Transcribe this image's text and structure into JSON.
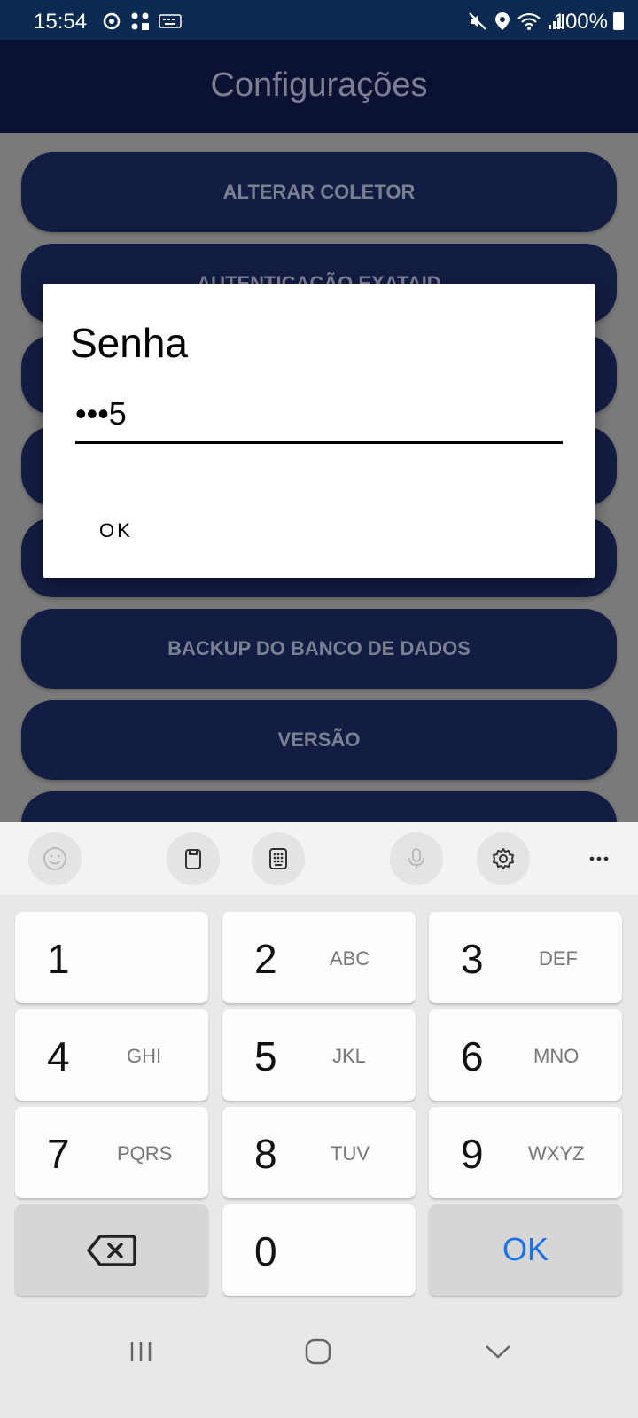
{
  "status_bar": {
    "time": "15:54",
    "battery": "100%",
    "icons": [
      "sync-icon",
      "apps-icon",
      "keyboard-icon",
      "mute-icon",
      "location-icon",
      "wifi-icon",
      "signal-icon",
      "battery-icon"
    ]
  },
  "app_bar": {
    "title": "Configurações"
  },
  "menu": {
    "alterar_coletor": "ALTERAR COLETOR",
    "autenticacao": "AUTENTICAÇÃO EXATAID",
    "backup": "BACKUP DO BANCO DE DADOS",
    "versao": "VERSÃO"
  },
  "dialog": {
    "title": "Senha",
    "password_display": "•••5",
    "ok_label": "OK"
  },
  "keyboard": {
    "toolbar_icons": [
      "emoji-icon",
      "clipboard-icon",
      "keypad-icon",
      "microphone-icon",
      "settings-icon",
      "more-icon"
    ],
    "keys": [
      {
        "num": "1",
        "letters": ""
      },
      {
        "num": "2",
        "letters": "ABC"
      },
      {
        "num": "3",
        "letters": "DEF"
      },
      {
        "num": "4",
        "letters": "GHI"
      },
      {
        "num": "5",
        "letters": "JKL"
      },
      {
        "num": "6",
        "letters": "MNO"
      },
      {
        "num": "7",
        "letters": "PQRS"
      },
      {
        "num": "8",
        "letters": "TUV"
      },
      {
        "num": "9",
        "letters": "WXYZ"
      },
      {
        "num": "0",
        "letters": ""
      }
    ],
    "ok_key": "OK"
  },
  "colors": {
    "status_bar": "#0b2a52",
    "app_bar": "#0b1133",
    "button": "#131c42",
    "ok_accent": "#1a73e8"
  }
}
